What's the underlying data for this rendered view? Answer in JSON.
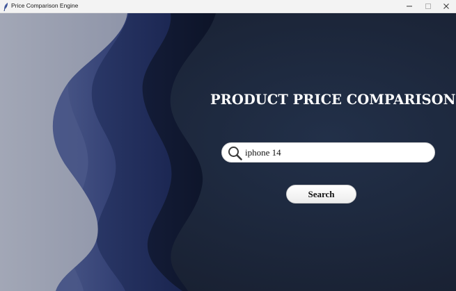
{
  "window": {
    "title": "Price Comparison Engine",
    "app_icon": "feather-icon",
    "controls": {
      "minimize_icon": "minimize-icon",
      "maximize_icon": "maximize-icon",
      "close_icon": "close-icon"
    }
  },
  "main": {
    "heading": "PRODUCT PRICE COMPARISON",
    "search": {
      "icon": "search-icon",
      "value": "iphone 14",
      "placeholder": ""
    },
    "search_button_label": "Search"
  },
  "colors": {
    "background_dark": "#1b2539",
    "wave_light": "#9da2b2",
    "wave_mid": "#2b3a6b",
    "text_light": "#ffffff"
  }
}
